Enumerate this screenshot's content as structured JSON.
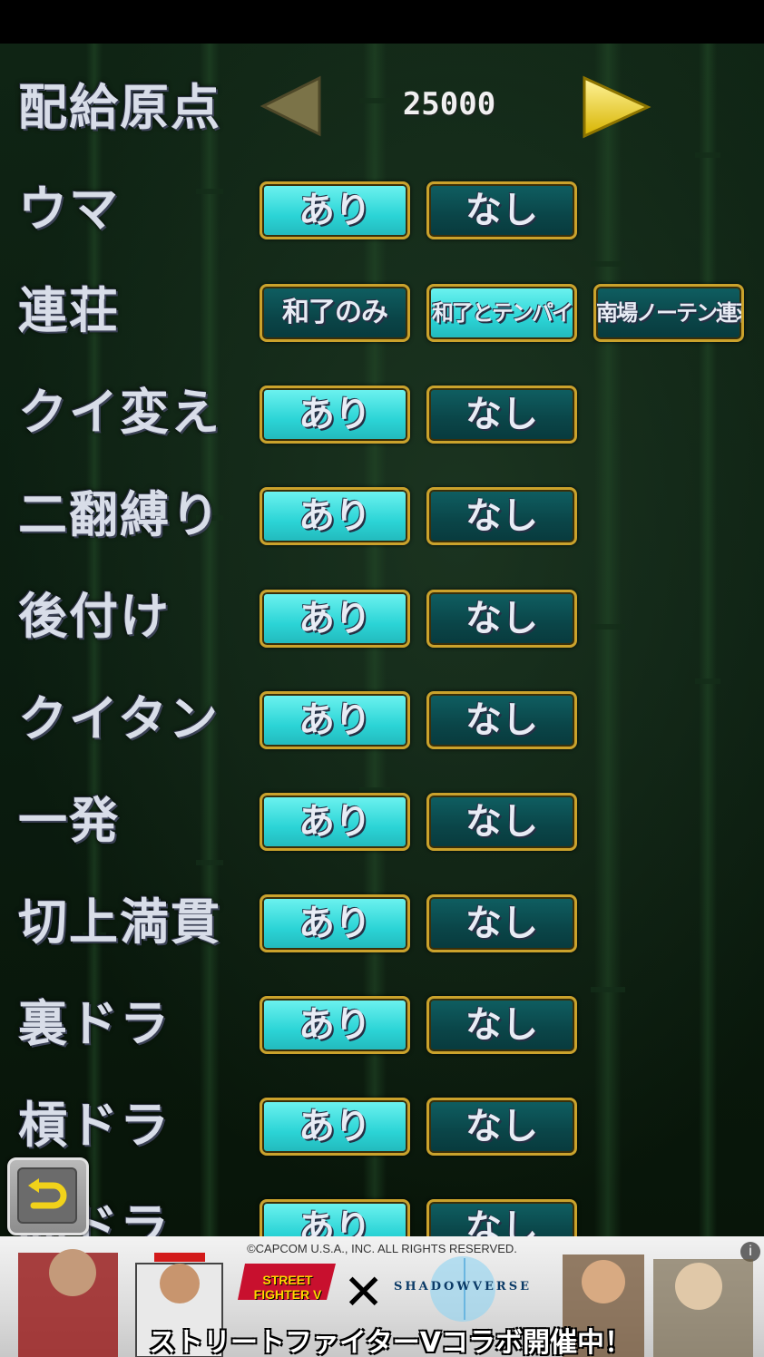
{
  "header": {
    "label": "配給原点",
    "value": "25000"
  },
  "rows": [
    {
      "label": "ウマ",
      "options": [
        "あり",
        "なし"
      ],
      "selected": 0
    },
    {
      "label": "連荘",
      "options": [
        "和了のみ",
        "和了とテンパイ",
        "南場ノーテン連荘"
      ],
      "selected": 1
    },
    {
      "label": "クイ変え",
      "options": [
        "あり",
        "なし"
      ],
      "selected": 0
    },
    {
      "label": "二翻縛り",
      "options": [
        "あり",
        "なし"
      ],
      "selected": 0
    },
    {
      "label": "後付け",
      "options": [
        "あり",
        "なし"
      ],
      "selected": 0
    },
    {
      "label": "クイタン",
      "options": [
        "あり",
        "なし"
      ],
      "selected": 0
    },
    {
      "label": "一発",
      "options": [
        "あり",
        "なし"
      ],
      "selected": 0
    },
    {
      "label": "切上満貫",
      "options": [
        "あり",
        "なし"
      ],
      "selected": 0
    },
    {
      "label": "裏ドラ",
      "options": [
        "あり",
        "なし"
      ],
      "selected": 0
    },
    {
      "label": "槓ドラ",
      "options": [
        "あり",
        "なし"
      ],
      "selected": 0
    },
    {
      "label": "赤ドラ",
      "options": [
        "あり",
        "なし"
      ],
      "selected": 0
    }
  ],
  "ad": {
    "copyright": "©CAPCOM U.S.A., INC. ALL RIGHTS RESERVED.",
    "brand_left": "STREET FIGHTER V",
    "cross": "✕",
    "brand_right": "SHADOWVERSE",
    "tagline": "ストリートファイターVコラボ開催中！",
    "info": "i"
  },
  "colors": {
    "on": "#2bd4d6",
    "off": "#0a4548",
    "border": "#caa22c"
  },
  "icons": {
    "prev": "left-arrow-icon",
    "next": "right-arrow-icon",
    "back": "return-icon"
  }
}
